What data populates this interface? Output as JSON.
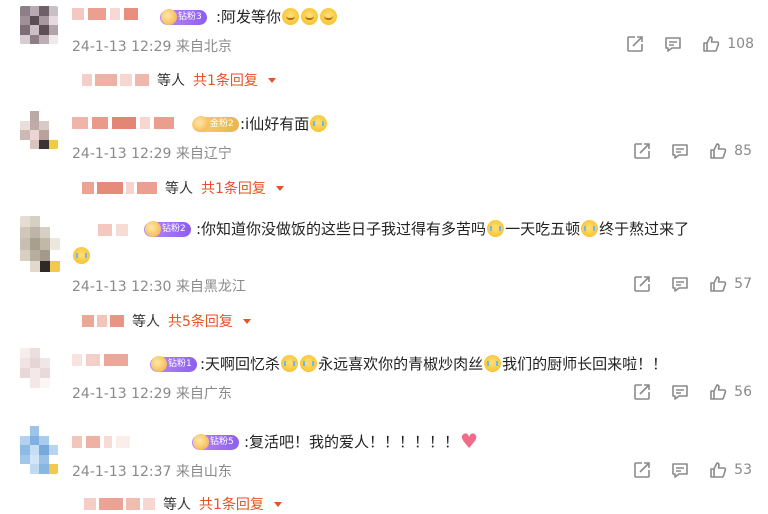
{
  "comments": [
    {
      "text_parts": [
        ":阿发等你"
      ],
      "emojis_after": [
        "smile",
        "smile",
        "smile"
      ],
      "badge": "钻粉3",
      "badge_color": "#9b6cf2",
      "time": "24-1-13 12:29 来自北京",
      "likes": "108",
      "reply_people": "等人",
      "reply_count": "共1条回复"
    },
    {
      "text_parts": [
        ":i仙好有面"
      ],
      "emojis_after": [
        "cry"
      ],
      "badge": "金粉2",
      "badge_color": "#e8b64a",
      "time": "24-1-13 12:29 来自辽宁",
      "likes": "85",
      "reply_people": "等人",
      "reply_count": "共1条回复"
    },
    {
      "text_line1_a": ":你知道你没做饭的这些日子我过得有多苦吗",
      "text_line1_b": "一天吃五顿",
      "text_line1_c": "终于熬过来了",
      "badge": "钻粉2",
      "badge_color": "#9b6cf2",
      "time": "24-1-13 12:30 来自黑龙江",
      "likes": "57",
      "reply_people": "等人",
      "reply_count": "共5条回复"
    },
    {
      "text_a": ":天啊回忆杀",
      "text_b": "永远喜欢你的青椒炒肉丝",
      "text_c": "我们的厨师长回来啦！！",
      "badge": "钻粉1",
      "badge_color": "#9b6cf2",
      "time": "24-1-13 12:29 来自广东",
      "likes": "56"
    },
    {
      "text_a": ":复活吧！我的爱人！！！！！！",
      "badge": "钻粉5",
      "badge_color": "#9b6cf2",
      "time": "24-1-13 12:37 来自山东",
      "likes": "53",
      "reply_people": "等人",
      "reply_count": "共1条回复"
    }
  ],
  "icons": [
    "share-icon",
    "comment-icon",
    "like-icon",
    "chevron-down-icon"
  ],
  "colors": {
    "accent": "#e8512a",
    "meta": "#8a8a8a"
  }
}
